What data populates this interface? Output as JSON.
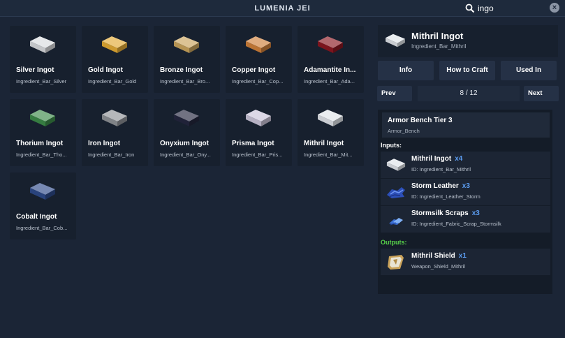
{
  "window": {
    "title": "LUMENIA JEI"
  },
  "search": {
    "value": "ingo"
  },
  "items": [
    {
      "name": "Silver Ingot",
      "id": "Ingredient_Bar_Silver",
      "color": "#d9dbde"
    },
    {
      "name": "Gold Ingot",
      "id": "Ingredient_Bar_Gold",
      "color": "#e4ab34"
    },
    {
      "name": "Bronze Ingot",
      "id": "Ingredient_Bar_Bro...",
      "color": "#c9a35c"
    },
    {
      "name": "Copper Ingot",
      "id": "Ingredient_Bar_Cop...",
      "color": "#d0803a"
    },
    {
      "name": "Adamantite In...",
      "id": "Ingredient_Bar_Ada...",
      "color": "#8a1620"
    },
    {
      "name": "Thorium Ingot",
      "id": "Ingredient_Bar_Tho...",
      "color": "#3c8a48"
    },
    {
      "name": "Iron Ingot",
      "id": "Ingredient_Bar_Iron",
      "color": "#8e9196"
    },
    {
      "name": "Onyxium Ingot",
      "id": "Ingredient_Bar_Ony...",
      "color": "#24263e"
    },
    {
      "name": "Prisma Ingot",
      "id": "Ingredient_Bar_Pris...",
      "color": "#c9c3d8"
    },
    {
      "name": "Mithril Ingot",
      "id": "Ingredient_Bar_Mit...",
      "color": "#dfe3e8"
    },
    {
      "name": "Cobalt Ingot",
      "id": "Ingredient_Bar_Cob...",
      "color": "#2d4a8a"
    }
  ],
  "detail": {
    "name": "Mithril Ingot",
    "id": "Ingredient_Bar_Mithril",
    "color": "#dfe3e8",
    "buttons": {
      "info": "Info",
      "how_to_craft": "How to Craft",
      "used_in": "Used In"
    },
    "pagination": {
      "prev": "Prev",
      "next": "Next",
      "indicator": "8 / 12"
    },
    "recipe": {
      "bench_name": "Armor Bench Tier 3",
      "bench_id": "Armor_Bench",
      "inputs_label": "Inputs:",
      "outputs_label": "Outputs:",
      "inputs_color": "#ffffff",
      "outputs_color": "#58d34a",
      "qty_color": "#5b9cf0",
      "inputs": [
        {
          "name": "Mithril Ingot",
          "qty": "x4",
          "id": "ID: Ingredient_Bar_Mithril",
          "icon": "mithril-ingot-icon"
        },
        {
          "name": "Storm Leather",
          "qty": "x3",
          "id": "ID: Ingredient_Leather_Storm",
          "icon": "storm-leather-icon"
        },
        {
          "name": "Stormsilk Scraps",
          "qty": "x3",
          "id": "ID: Ingredient_Fabric_Scrap_Stormsilk",
          "icon": "stormsilk-scraps-icon"
        }
      ],
      "outputs": [
        {
          "name": "Mithril Shield",
          "qty": "x1",
          "id": "Weapon_Shield_Mithril",
          "icon": "mithril-shield-icon"
        }
      ]
    }
  }
}
